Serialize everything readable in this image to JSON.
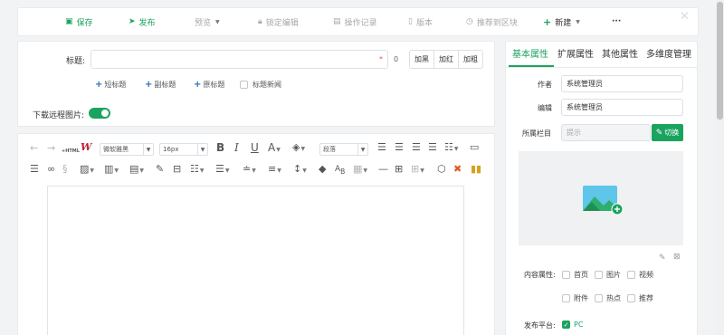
{
  "toolbar": {
    "save": "保存",
    "publish": "发布",
    "preview": "预览",
    "lock_edit": "锁定编辑",
    "op_log": "操作记录",
    "version": "版本",
    "recommend": "推荐到区块",
    "new": "新建",
    "more": "···",
    "close_icon": "close-icon"
  },
  "form": {
    "title_label": "标题:",
    "title_value": "",
    "title_required_mark": "*",
    "title_count": "0",
    "style_buttons": [
      "加黑",
      "加红",
      "加粗"
    ],
    "sub_links": [
      "短标题",
      "副标题",
      "原标题"
    ],
    "title_news_label": "标题新闻",
    "download_remote_label": "下载远程图片:",
    "download_remote_on": true
  },
  "editor": {
    "font_family": "微软雅黑",
    "font_size": "16px",
    "line_height": "段落",
    "bold": "B",
    "italic": "I",
    "underline": "U",
    "font_color": "A",
    "format_painter": "W",
    "html": "HTML"
  },
  "side": {
    "tabs": [
      "基本属性",
      "扩展属性",
      "其他属性",
      "多维度管理"
    ],
    "active_tab": 0,
    "author_label": "作者",
    "author_value": "系统管理员",
    "editor_label": "编辑",
    "editor_value": "系统管理员",
    "column_label": "所属栏目",
    "column_placeholder": "提示",
    "switch_button": "切换",
    "content_attr_label": "内容属性:",
    "content_attrs": [
      "首页",
      "图片",
      "视频",
      "附件",
      "热点",
      "推荐"
    ],
    "platform_label": "发布平台:",
    "platform_value": "PC",
    "platform_checked": true
  },
  "colors": {
    "accent": "#1aa35f",
    "link": "#2b6cb0",
    "disabled": "#a8a8a8"
  }
}
